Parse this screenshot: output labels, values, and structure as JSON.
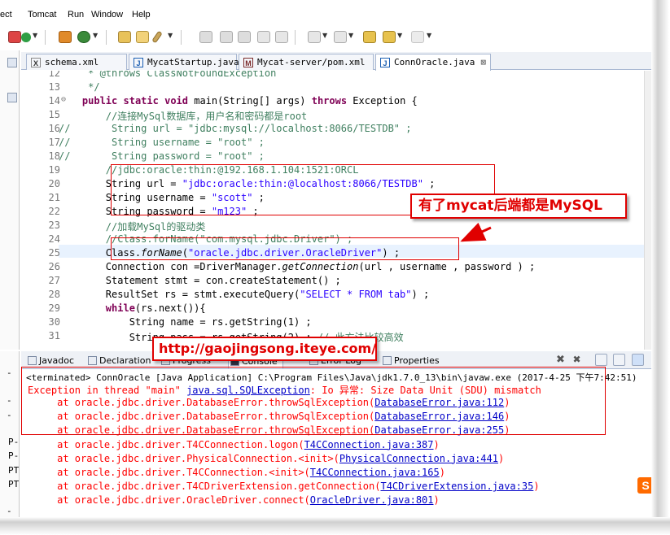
{
  "menu": {
    "items": [
      "ect",
      "Tomcat",
      "Run",
      "Window",
      "Help"
    ]
  },
  "tabs": [
    {
      "label": "schema.xml",
      "icon": "X"
    },
    {
      "label": "MycatStartup.java",
      "icon": "J"
    },
    {
      "label": "Mycat-server/pom.xml",
      "icon": "M"
    },
    {
      "label": "ConnOracle.java",
      "icon": "J",
      "active": true,
      "close": "⊠"
    }
  ],
  "editor": {
    "lines": [
      {
        "n": "12",
        "text": "     * @throws ClassNotFoundException"
      },
      {
        "n": "13",
        "text": "     */"
      },
      {
        "n": "14",
        "text": "    public static void main(String[] args) throws Exception {"
      },
      {
        "n": "15",
        "text": "        //连接MySql数据库，用户名和密码都是root"
      },
      {
        "n": "16",
        "text": "//       String url = \"jdbc:mysql://localhost:8066/TESTDB\" ;"
      },
      {
        "n": "17",
        "text": "//       String username = \"root\" ;"
      },
      {
        "n": "18",
        "text": "//       String password = \"root\" ;"
      },
      {
        "n": "19",
        "text": "        //jdbc:oracle:thin:@192.168.1.104:1521:ORCL"
      },
      {
        "n": "20",
        "text": "        String url = \"jdbc:oracle:thin:@localhost:8066/TESTDB\" ;"
      },
      {
        "n": "21",
        "text": "        String username = \"scott\" ;"
      },
      {
        "n": "22",
        "text": "        String password = \"m123\" ;"
      },
      {
        "n": "23",
        "text": "        //加载MySql的驱动类"
      },
      {
        "n": "24",
        "text": "        //Class.forName(\"com.mysql.jdbc.Driver\") ;"
      },
      {
        "n": "25",
        "text": "        Class.forName(\"oracle.jdbc.driver.OracleDriver\") ;"
      },
      {
        "n": "26",
        "text": "        Connection con =DriverManager.getConnection(url , username , password ) ;"
      },
      {
        "n": "27",
        "text": "        Statement stmt = con.createStatement() ;"
      },
      {
        "n": "28",
        "text": "        ResultSet rs = stmt.executeQuery(\"SELECT * FROM tab\") ;"
      },
      {
        "n": "29",
        "text": "        while(rs.next()){"
      },
      {
        "n": "30",
        "text": "            String name = rs.getString(1) ;"
      },
      {
        "n": "31",
        "text": "            String pass = rs.getString(2) ; // 此方法比较高效"
      }
    ]
  },
  "callout": {
    "text": "有了mycat后端都是MySQL"
  },
  "url_banner": {
    "text": "http://gaojingsong.iteye.com/"
  },
  "views": {
    "tabs": [
      "Javadoc",
      "Declaration",
      "Progress",
      "Console",
      "Error Log",
      "Properties"
    ]
  },
  "console": {
    "header": "<terminated> ConnOracle [Java Application] C:\\Program Files\\Java\\jdk1.7.0_13\\bin\\javaw.exe (2017-4-25 下午7:42:51)",
    "exception": {
      "pre": "Exception in thread \"main\" ",
      "link": "java.sql.SQLException",
      "post": ": Io 异常: Size Data Unit (SDU) mismatch"
    },
    "frames": [
      {
        "pre": "\tat oracle.jdbc.driver.DatabaseError.throwSqlException(",
        "link": "DatabaseError.java:112",
        "post": ")"
      },
      {
        "pre": "\tat oracle.jdbc.driver.DatabaseError.throwSqlException(",
        "link": "DatabaseError.java:146",
        "post": ")"
      },
      {
        "pre": "\tat oracle.jdbc.driver.DatabaseError.throwSqlException(",
        "link": "DatabaseError.java:255",
        "post": ")"
      },
      {
        "pre": "\tat oracle.jdbc.driver.T4CConnection.logon(",
        "link": "T4CConnection.java:387",
        "post": ")"
      },
      {
        "pre": "\tat oracle.jdbc.driver.PhysicalConnection.<init>(",
        "link": "PhysicalConnection.java:441",
        "post": ")"
      },
      {
        "pre": "\tat oracle.jdbc.driver.T4CConnection.<init>(",
        "link": "T4CConnection.java:165",
        "post": ")"
      },
      {
        "pre": "\tat oracle.jdbc.driver.T4CDriverExtension.getConnection(",
        "link": "T4CDriverExtension.java:35",
        "post": ")"
      },
      {
        "pre": "\tat oracle.jdbc.driver.OracleDriver.connect(",
        "link": "OracleDriver.java:801",
        "post": ")"
      }
    ]
  },
  "left_strip": {
    "items": [
      "-",
      "-",
      "-",
      "P-",
      "P-",
      "PT",
      "PT",
      "-"
    ]
  },
  "badge": {
    "text": "S"
  },
  "colors": {
    "annotation_red": "#e00000",
    "keyword": "#7f0055",
    "comment": "#3f7f5f",
    "string": "#2a00ff",
    "error": "#ff0000",
    "link": "#0000c8"
  }
}
